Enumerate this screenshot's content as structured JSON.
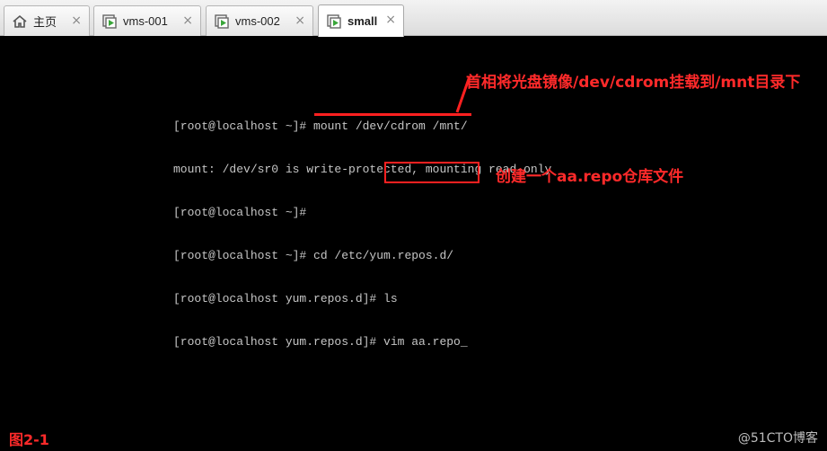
{
  "tabs": [
    {
      "label": "主页",
      "icon": "home-icon",
      "active": false
    },
    {
      "label": "vms-001",
      "icon": "vm-icon",
      "active": false
    },
    {
      "label": "vms-002",
      "icon": "vm-icon",
      "active": false
    },
    {
      "label": "small",
      "icon": "vm-icon",
      "active": true
    }
  ],
  "tab_close_glyph": "×",
  "terminal": {
    "lines": [
      "[root@localhost ~]# mount /dev/cdrom /mnt/",
      "mount: /dev/sr0 is write-protected, mounting read-only",
      "[root@localhost ~]#",
      "[root@localhost ~]# cd /etc/yum.repos.d/",
      "[root@localhost yum.repos.d]# ls",
      "[root@localhost yum.repos.d]# vim aa.repo"
    ],
    "cursor": "_"
  },
  "annotations": {
    "top": "首相将光盘镜像/dev/cdrom挂载到/mnt目录下",
    "middle": "创建一个aa.repo仓库文件"
  },
  "figure_label": "图2-1",
  "watermark": "@51CTO博客",
  "colors": {
    "annotation": "#ff2020",
    "terminal_text": "#c6c6c6",
    "console_bg": "#000000"
  }
}
